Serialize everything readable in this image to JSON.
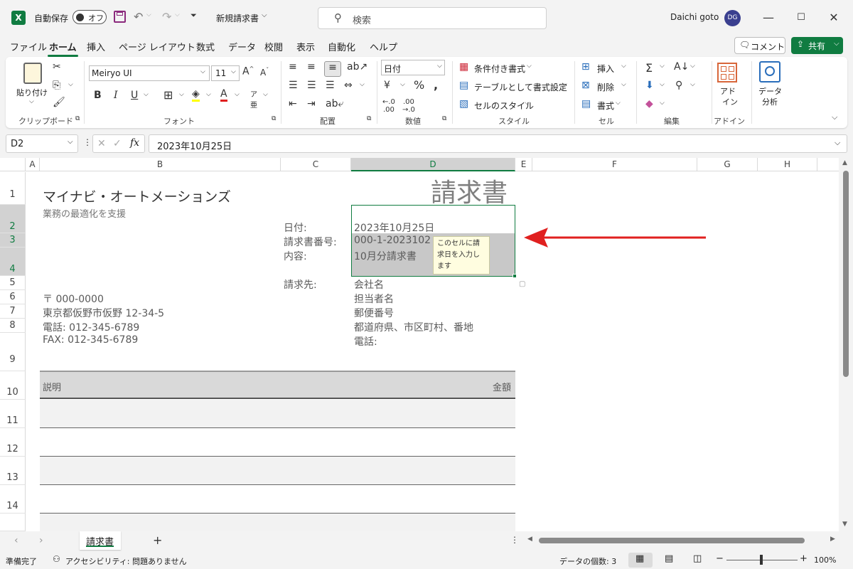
{
  "title_bar": {
    "autosave_label": "自動保存",
    "autosave_state": "オフ",
    "doc_title": "新規請求書",
    "search_placeholder": "検索",
    "user_name": "Daichi goto",
    "user_initials": "DG"
  },
  "menu_tabs": [
    "ファイル",
    "ホーム",
    "挿入",
    "ページ レイアウト",
    "数式",
    "データ",
    "校閲",
    "表示",
    "自動化",
    "ヘルプ"
  ],
  "active_tab": "ホーム",
  "top_right": {
    "comment_label": "コメント",
    "share_label": "共有"
  },
  "ribbon": {
    "clipboard": {
      "paste_label": "貼り付け",
      "group_label": "クリップボード"
    },
    "font": {
      "font_name": "Meiryo UI",
      "font_size": "11",
      "group_label": "フォント",
      "bold": "B",
      "italic": "I",
      "underline": "U"
    },
    "alignment": {
      "group_label": "配置"
    },
    "number": {
      "format": "日付",
      "group_label": "数値"
    },
    "styles": {
      "conditional": "条件付き書式",
      "table": "テーブルとして書式設定",
      "cell_style": "セルのスタイル",
      "group_label": "スタイル"
    },
    "cells": {
      "insert": "挿入",
      "delete": "削除",
      "format": "書式",
      "group_label": "セル"
    },
    "editing": {
      "group_label": "編集"
    },
    "addins": {
      "label_line1": "アド",
      "label_line2": "イン",
      "group_label": "アドイン"
    },
    "analysis": {
      "label_line1": "データ",
      "label_line2": "分析"
    }
  },
  "formula_bar": {
    "name_box": "D2",
    "formula": "2023年10月25日"
  },
  "columns": [
    "A",
    "B",
    "C",
    "D",
    "E",
    "F",
    "G",
    "H"
  ],
  "rows": [
    "1",
    "2",
    "3",
    "4",
    "5",
    "6",
    "7",
    "8",
    "9",
    "10",
    "11",
    "12",
    "13",
    "14"
  ],
  "sheet": {
    "company": "マイナビ・オートメーションズ",
    "tagline": "業務の最適化を支援",
    "invoice_title": "請求書",
    "date_label": "日付:",
    "date_value": "2023年10月25日",
    "invoice_no_label": "請求書番号:",
    "invoice_no_value": "000-1-2023102",
    "content_label": "内容:",
    "content_value": "10月分請求書",
    "tooltip": [
      "このセルに請",
      "求日を入力し",
      "ます"
    ],
    "bill_to_label": "請求先:",
    "bill_to_lines": [
      "会社名",
      "担当者名",
      "郵便番号",
      "都道府県、市区町村、番地",
      "電話:"
    ],
    "sender_lines": [
      "〒 000-0000",
      "東京都仮野市仮野 12-34-5",
      "電話: 012-345-6789",
      "FAX:  012-345-6789"
    ],
    "table_desc_header": "説明",
    "table_amount_header": "金額"
  },
  "sheet_tabs": {
    "active": "請求書",
    "add": "+"
  },
  "status_bar": {
    "ready": "準備完了",
    "accessibility": "アクセシビリティ: 問題ありません",
    "count": "データの個数: 3",
    "zoom": "100%"
  },
  "colors": {
    "excel_green": "#107c41",
    "arrow_red": "#e0201f",
    "band_gray": "#f2f2f2",
    "header_gray": "#d9d9d9"
  }
}
